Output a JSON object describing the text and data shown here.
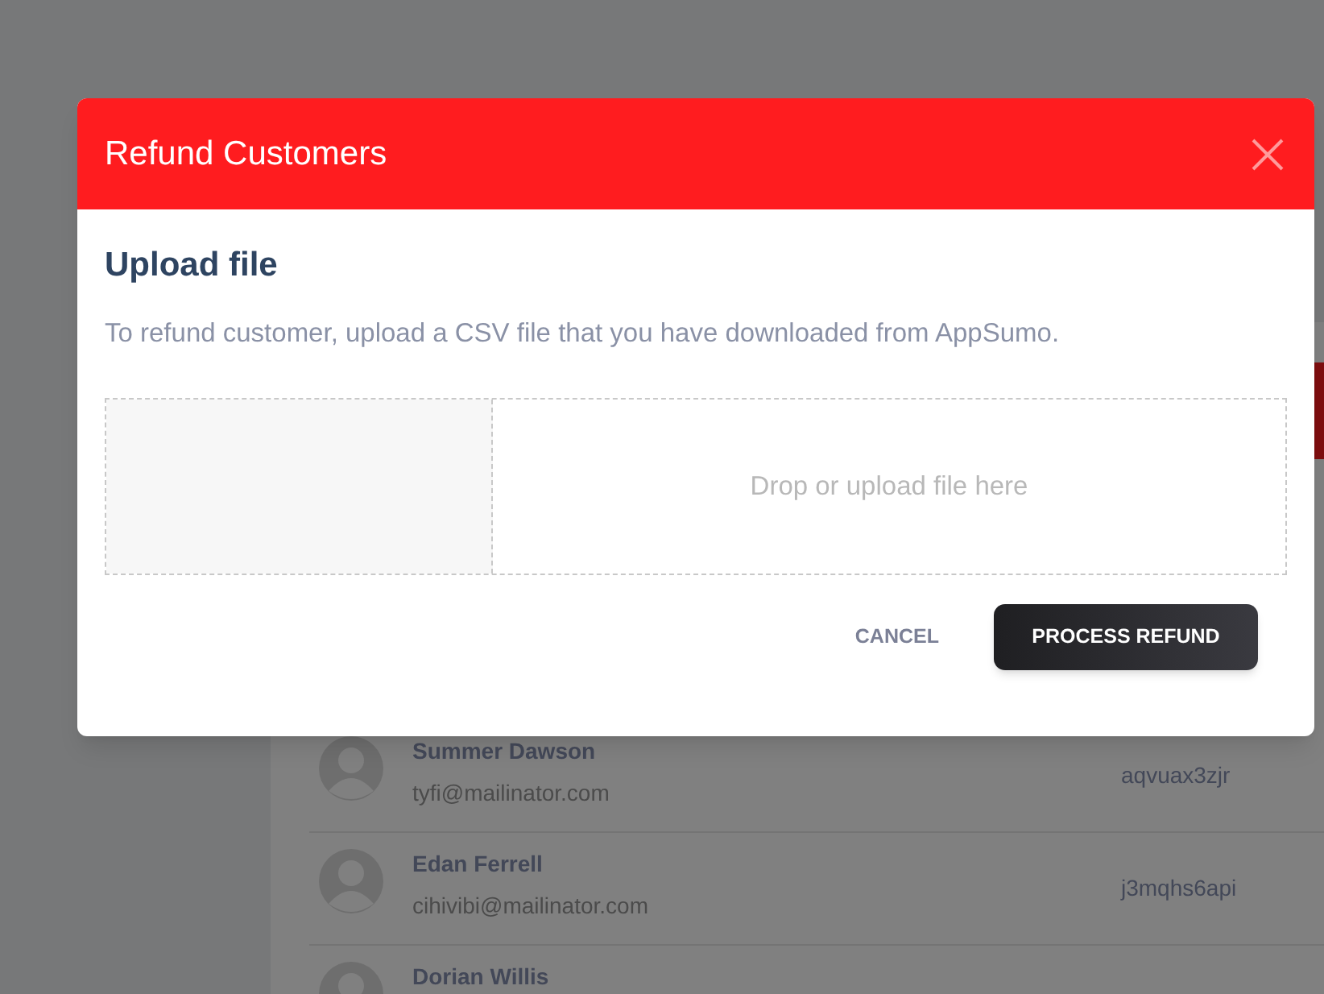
{
  "customers": [
    {
      "name": "Summer Dawson",
      "email": "tyfi@mailinator.com",
      "code": "aqvuax3zjr"
    },
    {
      "name": "Edan Ferrell",
      "email": "cihivibi@mailinator.com",
      "code": "j3mqhs6api"
    },
    {
      "name": "Dorian Willis"
    }
  ],
  "modal": {
    "title": "Refund Customers",
    "heading": "Upload file",
    "description": "To refund customer, upload a CSV file that you have downloaded from AppSumo.",
    "dropzone": {
      "placeholder": "Drop or upload file here"
    },
    "buttons": [
      {
        "label": "CANCEL",
        "kind": "text"
      },
      {
        "label": "PROCESS REFUND",
        "kind": "primary"
      }
    ]
  }
}
